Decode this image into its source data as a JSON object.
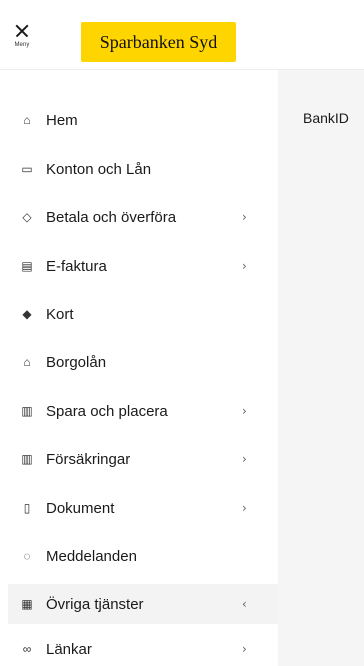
{
  "header": {
    "menu_label": "Meny",
    "logo_text": "Sparbanken Syd",
    "brand_color": "#ffd500"
  },
  "main": {
    "bankid_text": "BankID"
  },
  "sidebar": {
    "items": [
      {
        "label": "Hem",
        "icon": "home-icon",
        "has_submenu": false,
        "active": false
      },
      {
        "label": "Konton och Lån",
        "icon": "wallet-icon",
        "has_submenu": false,
        "active": false
      },
      {
        "label": "Betala och överföra",
        "icon": "tag-icon",
        "has_submenu": true,
        "expanded": false,
        "active": false
      },
      {
        "label": "E-faktura",
        "icon": "invoice-icon",
        "has_submenu": true,
        "expanded": false,
        "active": false
      },
      {
        "label": "Kort",
        "icon": "card-icon",
        "has_submenu": false,
        "active": false
      },
      {
        "label": "Borgolån",
        "icon": "house-loan-icon",
        "has_submenu": false,
        "active": false
      },
      {
        "label": "Spara och placera",
        "icon": "chart-icon",
        "has_submenu": true,
        "expanded": false,
        "active": false
      },
      {
        "label": "Försäkringar",
        "icon": "chart-icon",
        "has_submenu": true,
        "expanded": false,
        "active": false
      },
      {
        "label": "Dokument",
        "icon": "document-icon",
        "has_submenu": true,
        "expanded": false,
        "active": false
      },
      {
        "label": "Meddelanden",
        "icon": "message-icon",
        "has_submenu": false,
        "active": false
      },
      {
        "label": "Övriga tjänster",
        "icon": "services-icon",
        "has_submenu": true,
        "expanded": true,
        "active": true
      },
      {
        "label": "Länkar",
        "icon": "link-icon",
        "has_submenu": true,
        "expanded": false,
        "active": false
      }
    ],
    "chevron_collapsed": "›",
    "chevron_expanded": "‹"
  }
}
